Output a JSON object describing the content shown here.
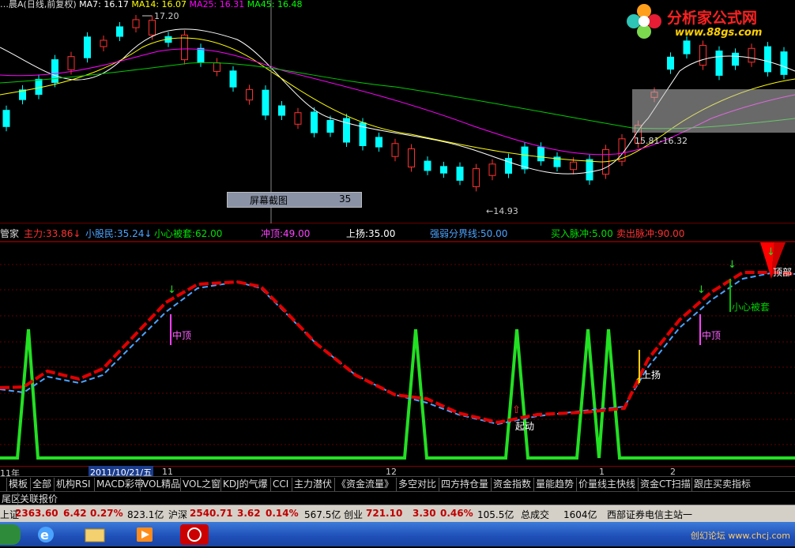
{
  "main_chart": {
    "title": "…晨A(日线,前复权)",
    "ma_labels": [
      {
        "text": "MA7: 16.17",
        "color": "#ffffff"
      },
      {
        "text": "MA14: 16.07",
        "color": "#ffff00"
      },
      {
        "text": "MA25: 16.31",
        "color": "#ff00ff"
      },
      {
        "text": "MA45: 16.48",
        "color": "#00ff00"
      }
    ],
    "high_label": "17.20",
    "low_label": "←14.93",
    "range_label": "15.81-16.32",
    "screenshot_button": {
      "label": "屏幕截图",
      "value": "35"
    }
  },
  "logo": {
    "title": "分析家公式网",
    "url": "www.88gs.com"
  },
  "indicator_header": {
    "name": "管家",
    "items": [
      {
        "label": "主力:",
        "value": "33.86",
        "arrow": "↓",
        "color": "#ff3030"
      },
      {
        "label": "小股民:",
        "value": "35.24",
        "arrow": "↓",
        "color": "#4ca3ff"
      },
      {
        "label": "小心被套:",
        "value": "62.00",
        "arrow": "",
        "color": "#00e000"
      },
      {
        "label": "冲顶:",
        "value": "49.00",
        "arrow": "",
        "color": "#ff40ff"
      },
      {
        "label": "上扬:",
        "value": "35.00",
        "arrow": "",
        "color": "#ffffff"
      },
      {
        "label": "强弱分界线:",
        "value": "50.00",
        "arrow": "",
        "color": "#4ca3ff"
      },
      {
        "label": "买入脉冲:",
        "value": "5.00",
        "arrow": "",
        "color": "#00e000"
      },
      {
        "label": "卖出脉冲:",
        "value": "90.00",
        "arrow": "",
        "color": "#ff3030"
      }
    ]
  },
  "indicator_annotations": {
    "zhongding": "中顶",
    "shangyang": "上扬",
    "qidong": "起动",
    "xiaoxin": "小心被套",
    "dingbu": "顶部"
  },
  "x_axis": {
    "year_label": "11年",
    "date_cursor": "2011/10/21/五",
    "months": [
      "11",
      "12",
      "1",
      "2"
    ]
  },
  "tabs": [
    "模板",
    "全部",
    "机构RSI",
    "MACD彩带",
    "VOL精品",
    "VOL之窗",
    "KDJ的气爆",
    "CCI",
    "主力潜伏",
    "《资金流量》",
    "多空对比",
    "四方持仓量",
    "资金指数",
    "量能趋势",
    "价量线主快线",
    "资金CT扫描",
    "跟庄买卖指标"
  ],
  "row2": [
    "尾区",
    "关联报价"
  ],
  "status_bar": [
    {
      "label": "上证",
      "value": "2363.60",
      "change": "6.42",
      "pct": "0.27%",
      "amount": "823.1亿"
    },
    {
      "label": "沪深",
      "value": "2540.71",
      "change": "3.62",
      "pct": "0.14%",
      "amount": "567.5亿"
    },
    {
      "label": "创业",
      "value": "721.10",
      "change": "3.30",
      "pct": "0.46%",
      "amount": "105.5亿"
    },
    {
      "label": "总成交",
      "value": "1604亿"
    },
    {
      "label": "西部证券电信主站一",
      "value": ""
    }
  ],
  "watermark": "创幻论坛 www.chcj.com",
  "colors": {
    "up": "#ff3030",
    "down": "#00ffff",
    "main_line": "#ff0000",
    "retail_line": "#4ca3ff",
    "pulse": "#00ff00"
  }
}
